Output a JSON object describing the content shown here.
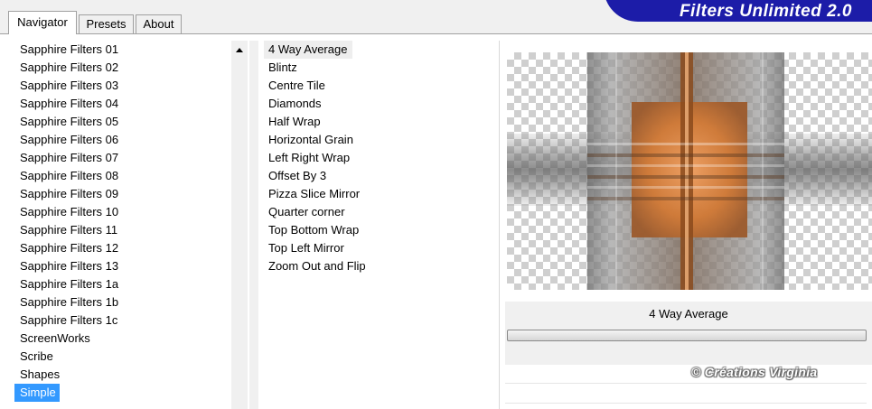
{
  "tabs": [
    {
      "label": "Navigator",
      "active": true
    },
    {
      "label": "Presets",
      "active": false
    },
    {
      "label": "About",
      "active": false
    }
  ],
  "banner": {
    "title": "Filters Unlimited 2.0"
  },
  "categories": {
    "items": [
      "Sapphire Filters 01",
      "Sapphire Filters 02",
      "Sapphire Filters 03",
      "Sapphire Filters 04",
      "Sapphire Filters 05",
      "Sapphire Filters 06",
      "Sapphire Filters 07",
      "Sapphire Filters 08",
      "Sapphire Filters 09",
      "Sapphire Filters 10",
      "Sapphire Filters 11",
      "Sapphire Filters 12",
      "Sapphire Filters 13",
      "Sapphire Filters 1a",
      "Sapphire Filters 1b",
      "Sapphire Filters 1c",
      "ScreenWorks",
      "Scribe",
      "Shapes",
      "Simple"
    ],
    "selected": "Simple"
  },
  "filters": {
    "items": [
      "4 Way Average",
      "Blintz",
      "Centre Tile",
      "Diamonds",
      "Half Wrap",
      "Horizontal Grain",
      "Left Right Wrap",
      "Offset By 3",
      "Pizza Slice Mirror",
      "Quarter corner",
      "Top Bottom Wrap",
      "Top Left Mirror",
      "Zoom Out and Flip"
    ],
    "highlighted": "4 Way Average"
  },
  "preview": {
    "filter_name": "4 Way Average"
  },
  "watermark": {
    "text": "© Créations Virginia"
  },
  "colors": {
    "selection": "#3399ff",
    "banner": "#1c1ca8",
    "preview_accent": "#d27a36"
  }
}
